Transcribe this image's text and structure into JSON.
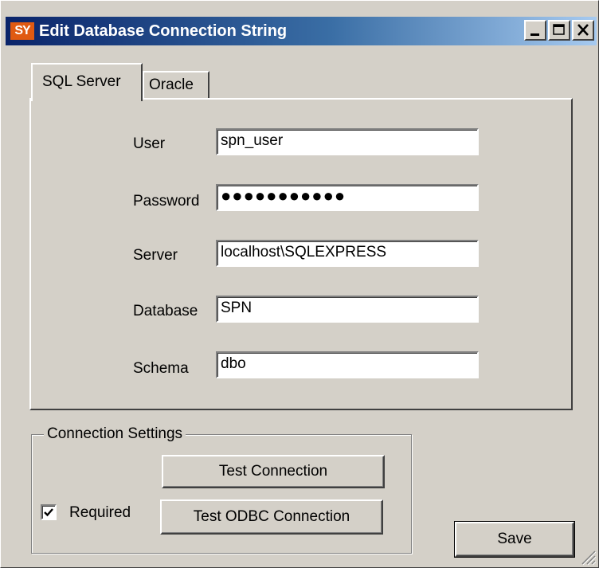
{
  "window": {
    "title": "Edit Database Connection String",
    "app_icon_text": "SY"
  },
  "tabs": [
    {
      "label": "SQL Server",
      "active": true
    },
    {
      "label": "Oracle",
      "active": false
    }
  ],
  "form": {
    "user_label": "User",
    "user_value": "spn_user",
    "password_label": "Password",
    "password_value": "●●●●●●●●●●●",
    "server_label": "Server",
    "server_value": "localhost\\SQLEXPRESS",
    "database_label": "Database",
    "database_value": "SPN",
    "schema_label": "Schema",
    "schema_value": "dbo"
  },
  "connection_settings": {
    "legend": "Connection Settings",
    "test_connection_label": "Test Connection",
    "test_odbc_label": "Test ODBC Connection",
    "required_label": "Required",
    "required_checked": true
  },
  "footer": {
    "save_label": "Save"
  },
  "colors": {
    "titlebar_start": "#0a246a",
    "titlebar_end": "#a6caf0",
    "face": "#d4d0c8",
    "app_icon_bg": "#e05a12"
  }
}
